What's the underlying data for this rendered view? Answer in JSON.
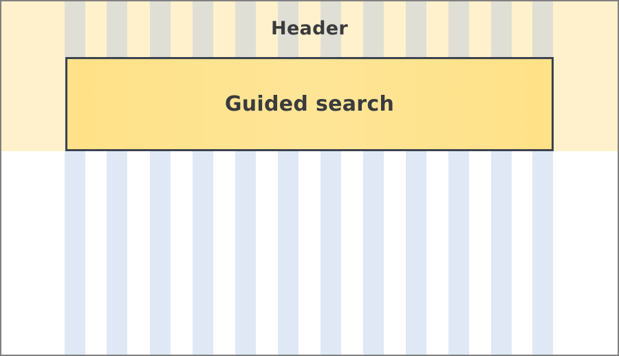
{
  "diagram": {
    "header_label": "Header",
    "guided_search_label": "Guided search"
  },
  "colors": {
    "header_band": "#fff1cc",
    "guided_search_fill": "#fee596",
    "guided_search_border": "#3b4250",
    "grid_column": "#e1e8f4",
    "frame_border": "#808080",
    "text": "#3a3b3e"
  }
}
